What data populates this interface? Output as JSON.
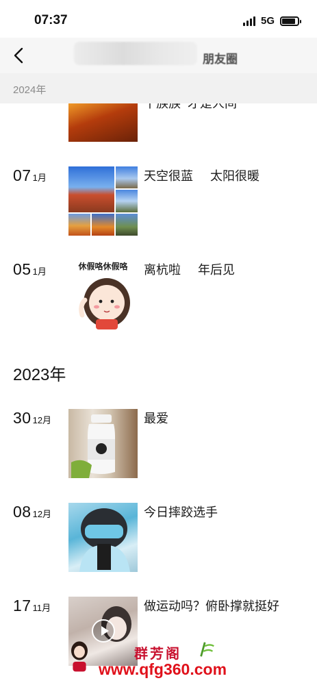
{
  "status": {
    "time": "07:37",
    "network": "5G",
    "battery_level": 0.85
  },
  "nav": {
    "title": "朋友圈",
    "back_icon": "chevron-left-icon"
  },
  "sticky_year": "2024年",
  "posts_2024": [
    {
      "day": "",
      "month": "",
      "text": "千族族  才是人间",
      "thumb": "fire"
    },
    {
      "day": "07",
      "month": "1月",
      "text": "天空很蓝     太阳很暖",
      "thumb": "grid"
    },
    {
      "day": "05",
      "month": "1月",
      "text": "离杭啦     年后见",
      "thumb": "sticker",
      "sticker_text": "休假咯休假咯"
    }
  ],
  "year_2023": "2023年",
  "posts_2023": [
    {
      "day": "30",
      "month": "12月",
      "text": "最爱",
      "thumb": "milk"
    },
    {
      "day": "08",
      "month": "12月",
      "text": "今日摔跤选手",
      "thumb": "selfie"
    },
    {
      "day": "17",
      "month": "11月",
      "text": "做运动吗？俯卧撑就挺好",
      "thumb": "video"
    }
  ],
  "watermark": {
    "line1": "群芳阁",
    "line2": "www.qfg360.com"
  }
}
